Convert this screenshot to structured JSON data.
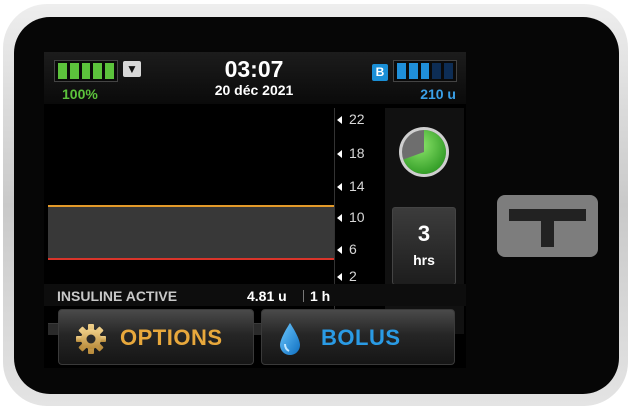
{
  "status_bar": {
    "battery_percent": "100%",
    "battery_level": 1.0,
    "time": "03:07",
    "date": "20 déc 2021",
    "bolus_badge": "B",
    "insulin_remaining": "210 u",
    "cartridge_level": 0.75
  },
  "graph": {
    "y_ticks": [
      "22",
      "18",
      "14",
      "10",
      "6",
      "2"
    ],
    "target_high": 10,
    "target_low": 3.9,
    "y_range": [
      2,
      22
    ]
  },
  "timeframe": {
    "value": "3",
    "unit": "hrs"
  },
  "iob": {
    "label": "INSULINE ACTIVE",
    "value": "4.81 u",
    "duration": "1 h"
  },
  "buttons": {
    "options_label": "OPTIONS",
    "bolus_label": "BOLUS"
  },
  "colors": {
    "battery_green": "#5cc33c",
    "insulin_blue": "#1f8fd9",
    "options_orange": "#e8a83c",
    "target_high_orange": "#e39a2a",
    "target_low_red": "#d9342a"
  },
  "icons": {
    "antenna": "antenna-icon",
    "options": "gear-icon",
    "bolus": "drop-icon",
    "iob": "pie-timer-icon"
  }
}
